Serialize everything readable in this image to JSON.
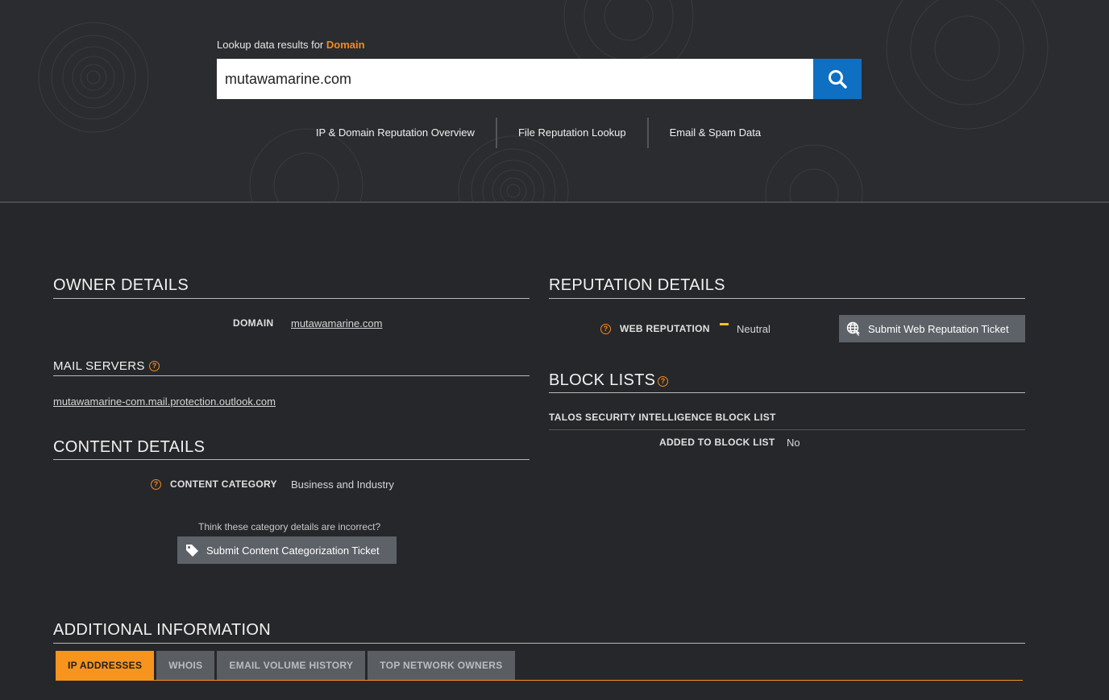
{
  "header": {
    "lookup_prefix": "Lookup data results for",
    "lookup_type": "Domain",
    "search_value": "mutawamarine.com",
    "search_icon": "search-icon",
    "nav": [
      "IP & Domain Reputation Overview",
      "File Reputation Lookup",
      "Email & Spam Data"
    ]
  },
  "owner": {
    "title": "OWNER DETAILS",
    "domain_label": "DOMAIN",
    "domain_value": "mutawamarine.com"
  },
  "mail": {
    "title": "MAIL SERVERS",
    "server": "mutawamarine-com.mail.protection.outlook.com"
  },
  "content": {
    "title": "CONTENT DETAILS",
    "category_label": "CONTENT CATEGORY",
    "category_value": "Business and Industry",
    "prompt": "Think these category details are incorrect?",
    "button": "Submit Content Categorization Ticket",
    "button_icon": "tag-icon"
  },
  "reputation": {
    "title": "REPUTATION DETAILS",
    "web_label": "WEB REPUTATION",
    "web_value": "Neutral",
    "button": "Submit Web Reputation Ticket",
    "button_icon": "globe-icon",
    "indicator_color": "#f0c419"
  },
  "blocklists": {
    "title": "BLOCK LISTS",
    "list_name": "TALOS SECURITY INTELLIGENCE BLOCK LIST",
    "added_label": "ADDED TO BLOCK LIST",
    "added_value": "No"
  },
  "additional": {
    "title": "ADDITIONAL INFORMATION",
    "tabs": [
      "IP ADDRESSES",
      "WHOIS",
      "EMAIL VOLUME HISTORY",
      "TOP NETWORK OWNERS"
    ],
    "active_tab": "IP ADDRESSES"
  },
  "colors": {
    "accent": "#f7941d",
    "search_button": "#0f6fc2",
    "background": "#26272a"
  }
}
